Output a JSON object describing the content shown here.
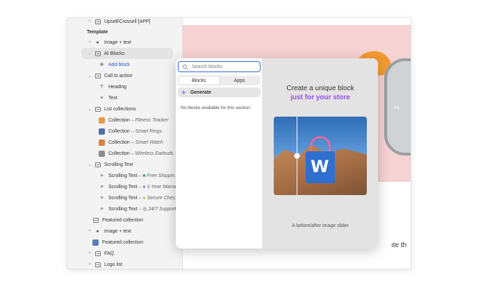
{
  "sidebar": {
    "top_item": "Upsell/Crossell [APP]",
    "section_label": "Template",
    "items": [
      {
        "label": "Image + text"
      },
      {
        "label": "AI Blocks"
      },
      {
        "label": "Add block"
      },
      {
        "label": "Call to action"
      },
      {
        "label": "Heading"
      },
      {
        "label": "Text"
      },
      {
        "label": "List collections"
      },
      {
        "label": "Collection",
        "detail": "Fitness Tracker"
      },
      {
        "label": "Collection",
        "detail": "Smart Rings"
      },
      {
        "label": "Collection",
        "detail": "Smart Watch"
      },
      {
        "label": "Collection",
        "detail": "Wireless Earbuds"
      },
      {
        "label": "Scrolling Text"
      },
      {
        "label": "Scrolling Text",
        "detail": "Free Shippin..."
      },
      {
        "label": "Scrolling Text",
        "detail": "1-Year Warra..."
      },
      {
        "label": "Scrolling Text",
        "detail": "Secure Chec..."
      },
      {
        "label": "Scrolling Text",
        "detail": "24/7 Support"
      },
      {
        "label": "Featured collection"
      },
      {
        "label": "Image + text"
      },
      {
        "label": "Featured collection"
      },
      {
        "label": "FAQ"
      },
      {
        "label": "Logo list"
      }
    ],
    "separator": "–"
  },
  "picker": {
    "search_placeholder": "Search blocks",
    "tabs": [
      "Blocks",
      "Apps"
    ],
    "generate_label": "Generate",
    "empty_message": "No blocks available for this section.",
    "promo_title": "Create a unique block",
    "promo_subtitle": "just for your store",
    "promo_caption": "A before/after image slider",
    "carousel": {
      "pages": 3,
      "active": 2
    }
  },
  "preview": {
    "tail_text": "ıte th",
    "watch_text": "mi"
  },
  "colors": {
    "accent_purple": "#8e4ff0",
    "search_border": "#2c6ecb",
    "hero_pink": "#f6d2d2"
  }
}
